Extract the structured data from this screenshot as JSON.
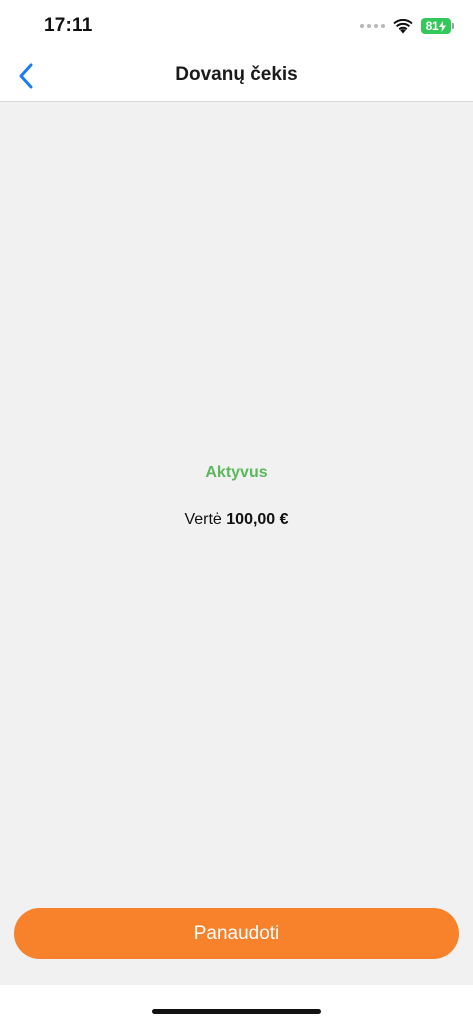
{
  "status_bar": {
    "time": "17:11",
    "battery_level": "81",
    "icons": [
      "signal-dots-icon",
      "wifi-icon",
      "battery-charging-icon"
    ]
  },
  "nav": {
    "title": "Dovanų čekis",
    "back_icon": "chevron-left-icon"
  },
  "voucher": {
    "status": "Aktyvus",
    "value_label": "Vertė",
    "value_amount": "100,00 €"
  },
  "actions": {
    "use_label": "Panaudoti"
  },
  "colors": {
    "accent_blue": "#1a7cf5",
    "status_green": "#5cb85c",
    "button_orange": "#f8812b",
    "battery_green": "#34c759",
    "background_gray": "#f1f1f1"
  }
}
